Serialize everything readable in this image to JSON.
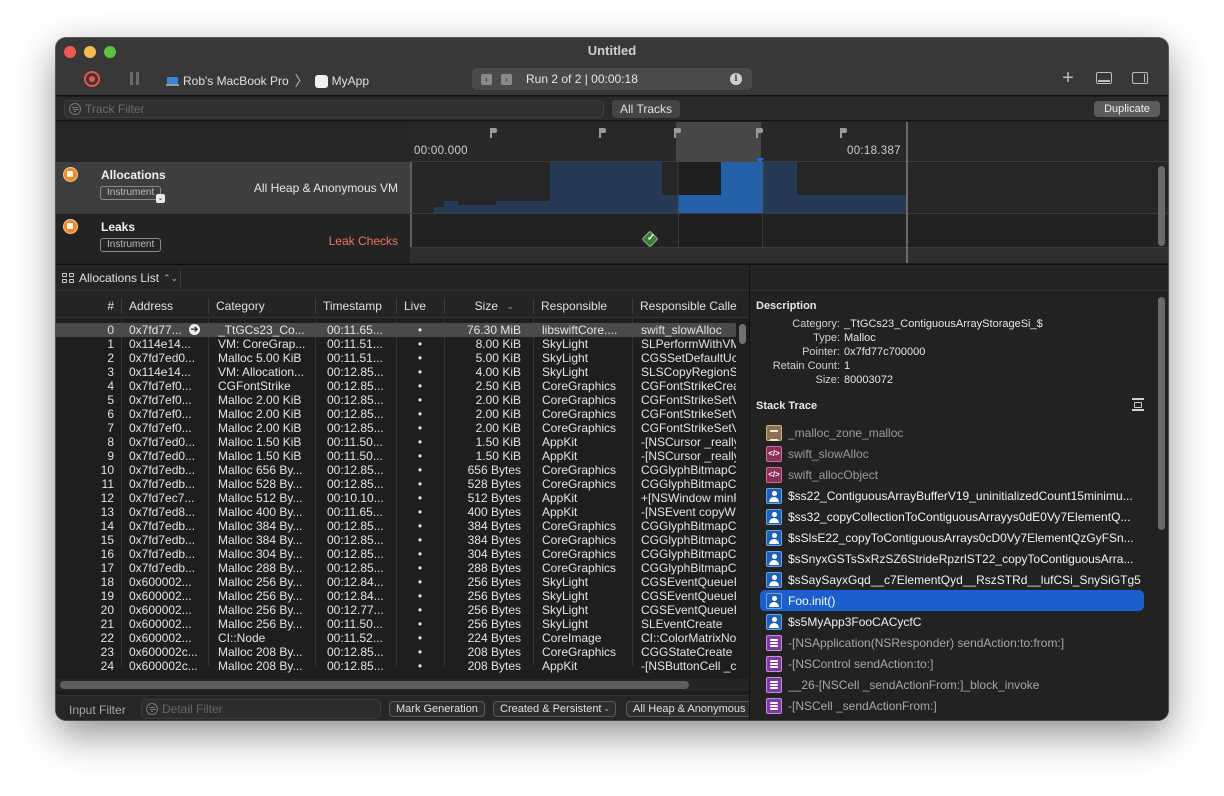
{
  "window": {
    "title": "Untitled",
    "target_device": "Rob's MacBook Pro",
    "target_app": "MyApp",
    "run_label": "Run 2 of 2  |  00:00:18"
  },
  "toolbar": {
    "record_icon": "record-icon",
    "pause_icon": "pause-icon",
    "add_icon": "plus-icon",
    "bottom_panel_icon": "panel-bottom-icon",
    "right_panel_icon": "panel-right-icon",
    "info_icon": "info-icon"
  },
  "filter_bar": {
    "track_filter_placeholder": "Track Filter",
    "all_tracks_label": "All Tracks",
    "duplicate_label": "Duplicate"
  },
  "timeline": {
    "start_label": "00:00.000",
    "end_label": "00:18.387",
    "selection_start_fraction": 0.54,
    "selection_end_fraction": 0.705,
    "tracks": [
      {
        "name": "Allocations",
        "badge": "Instrument",
        "detail": "All Heap & Anonymous VM",
        "icon": "allocations-icon"
      },
      {
        "name": "Leaks",
        "badge": "Instrument",
        "detail": "Leak Checks",
        "icon": "leaks-icon"
      }
    ],
    "leak_check_status": "passed"
  },
  "list": {
    "selector_label": "Allocations List",
    "columns": [
      "#",
      "Address",
      "Category",
      "Timestamp",
      "Live",
      "Size",
      "Responsible",
      "Responsible Calle"
    ],
    "sort_column": "Size",
    "rows": [
      [
        "0",
        "0x7fd77...",
        "_TtGCs23_Co...",
        "00:11.65...",
        "•",
        "76.30 MiB",
        "libswiftCore....",
        "swift_slowAlloc"
      ],
      [
        "1",
        "0x114e14...",
        "VM: CoreGrap...",
        "00:11.51...",
        "•",
        "8.00 KiB",
        "SkyLight",
        "SLPerformWithVM"
      ],
      [
        "2",
        "0x7fd7ed0...",
        "Malloc 5.00 KiB",
        "00:11.51...",
        "•",
        "5.00 KiB",
        "SkyLight",
        "CGSSetDefaultUc"
      ],
      [
        "3",
        "0x114e14...",
        "VM: Allocation...",
        "00:12.85...",
        "•",
        "4.00 KiB",
        "SkyLight",
        "SLSCopyRegionSe"
      ],
      [
        "4",
        "0x7fd7ef0...",
        "CGFontStrike",
        "00:12.85...",
        "•",
        "2.50 KiB",
        "CoreGraphics",
        "CGFontStrikeCrea"
      ],
      [
        "5",
        "0x7fd7ef0...",
        "Malloc 2.00 KiB",
        "00:12.85...",
        "•",
        "2.00 KiB",
        "CoreGraphics",
        "CGFontStrikeSetV"
      ],
      [
        "6",
        "0x7fd7ef0...",
        "Malloc 2.00 KiB",
        "00:12.85...",
        "•",
        "2.00 KiB",
        "CoreGraphics",
        "CGFontStrikeSetV"
      ],
      [
        "7",
        "0x7fd7ef0...",
        "Malloc 2.00 KiB",
        "00:12.85...",
        "•",
        "2.00 KiB",
        "CoreGraphics",
        "CGFontStrikeSetV"
      ],
      [
        "8",
        "0x7fd7ed0...",
        "Malloc 1.50 KiB",
        "00:11.50...",
        "•",
        "1.50 KiB",
        "AppKit",
        "-[NSCursor _really"
      ],
      [
        "9",
        "0x7fd7ed0...",
        "Malloc 1.50 KiB",
        "00:11.50...",
        "•",
        "1.50 KiB",
        "AppKit",
        "-[NSCursor _really"
      ],
      [
        "10",
        "0x7fd7edb...",
        "Malloc 656 By...",
        "00:12.85...",
        "•",
        "656 Bytes",
        "CoreGraphics",
        "CGGlyphBitmapCr"
      ],
      [
        "11",
        "0x7fd7edb...",
        "Malloc 528 By...",
        "00:12.85...",
        "•",
        "528 Bytes",
        "CoreGraphics",
        "CGGlyphBitmapCr"
      ],
      [
        "12",
        "0x7fd7ec7...",
        "Malloc 512 By...",
        "00:10.10...",
        "•",
        "512 Bytes",
        "AppKit",
        "+[NSWindow minF"
      ],
      [
        "13",
        "0x7fd7ed8...",
        "Malloc 400 By...",
        "00:11.65...",
        "•",
        "400 Bytes",
        "AppKit",
        "-[NSEvent copyW"
      ],
      [
        "14",
        "0x7fd7edb...",
        "Malloc 384 By...",
        "00:12.85...",
        "•",
        "384 Bytes",
        "CoreGraphics",
        "CGGlyphBitmapCr"
      ],
      [
        "15",
        "0x7fd7edb...",
        "Malloc 384 By...",
        "00:12.85...",
        "•",
        "384 Bytes",
        "CoreGraphics",
        "CGGlyphBitmapCr"
      ],
      [
        "16",
        "0x7fd7edb...",
        "Malloc 304 By...",
        "00:12.85...",
        "•",
        "304 Bytes",
        "CoreGraphics",
        "CGGlyphBitmapCr"
      ],
      [
        "17",
        "0x7fd7edb...",
        "Malloc 288 By...",
        "00:12.85...",
        "•",
        "288 Bytes",
        "CoreGraphics",
        "CGGlyphBitmapCr"
      ],
      [
        "18",
        "0x600002...",
        "Malloc 256 By...",
        "00:12.84...",
        "•",
        "256 Bytes",
        "SkyLight",
        "CGSEventQueueE"
      ],
      [
        "19",
        "0x600002...",
        "Malloc 256 By...",
        "00:12.84...",
        "•",
        "256 Bytes",
        "SkyLight",
        "CGSEventQueueE"
      ],
      [
        "20",
        "0x600002...",
        "Malloc 256 By...",
        "00:12.77...",
        "•",
        "256 Bytes",
        "SkyLight",
        "CGSEventQueueE"
      ],
      [
        "21",
        "0x600002...",
        "Malloc 256 By...",
        "00:11.50...",
        "•",
        "256 Bytes",
        "SkyLight",
        "SLEventCreate"
      ],
      [
        "22",
        "0x600002...",
        "CI::Node",
        "00:11.52...",
        "•",
        "224 Bytes",
        "CoreImage",
        "CI::ColorMatrixNo"
      ],
      [
        "23",
        "0x600002c...",
        "Malloc 208 By...",
        "00:12.85...",
        "•",
        "208 Bytes",
        "CoreGraphics",
        "CGGStateCreate"
      ],
      [
        "24",
        "0x600002c...",
        "Malloc 208 By...",
        "00:12.85...",
        "•",
        "208 Bytes",
        "AppKit",
        "-[NSButtonCell _c"
      ]
    ],
    "selected_row": 0
  },
  "bottom_bar": {
    "input_filter_label": "Input Filter",
    "detail_filter_placeholder": "Detail Filter",
    "mark_generation_label": "Mark Generation",
    "lifespan_label": "Created & Persistent",
    "allocation_type_label": "All Heap & Anonymous VM"
  },
  "inspector": {
    "description_title": "Description",
    "fields": [
      {
        "key": "Category:",
        "value": "_TtGCs23_ContiguousArrayStorageSi_$"
      },
      {
        "key": "Type:",
        "value": "Malloc"
      },
      {
        "key": "Pointer:",
        "value": "0x7fd77c700000"
      },
      {
        "key": "Retain Count:",
        "value": "1"
      },
      {
        "key": "Size:",
        "value": "80003072"
      }
    ],
    "stack_title": "Stack Trace",
    "frames": [
      {
        "label": "_malloc_zone_malloc",
        "kind": "lib",
        "icon": "system-library-icon"
      },
      {
        "label": "swift_slowAlloc",
        "kind": "code",
        "icon": "swift-code-icon"
      },
      {
        "label": "swift_allocObject",
        "kind": "code",
        "icon": "swift-code-icon"
      },
      {
        "label": "$ss22_ContiguousArrayBufferV19_uninitializedCount15minimu...",
        "kind": "user",
        "icon": "user-code-icon"
      },
      {
        "label": "$ss32_copyCollectionToContiguousArrayys0dE0Vy7ElementQ...",
        "kind": "user",
        "icon": "user-code-icon"
      },
      {
        "label": "$sSlsE22_copyToContiguousArrays0cD0Vy7ElementQzGyFSn...",
        "kind": "user",
        "icon": "user-code-icon"
      },
      {
        "label": "$sSnyxGSTsSxRzSZ6StrideRpzrlST22_copyToContiguousArra...",
        "kind": "user",
        "icon": "user-code-icon"
      },
      {
        "label": "$sSaySayxGqd__c7ElementQyd__RszSTRd__lufCSi_SnySiGTg5",
        "kind": "user",
        "icon": "user-code-icon"
      },
      {
        "label": "Foo.init()",
        "kind": "user",
        "icon": "user-code-icon",
        "selected": true
      },
      {
        "label": "$s5MyApp3FooCACycfC",
        "kind": "user",
        "icon": "user-code-icon"
      },
      {
        "label": "-[NSApplication(NSResponder) sendAction:to:from:]",
        "kind": "fw",
        "icon": "framework-icon"
      },
      {
        "label": "-[NSControl sendAction:to:]",
        "kind": "fw",
        "icon": "framework-icon"
      },
      {
        "label": "__26-[NSCell _sendActionFrom:]_block_invoke",
        "kind": "fw",
        "icon": "framework-icon"
      },
      {
        "label": "-[NSCell _sendActionFrom:]",
        "kind": "fw",
        "icon": "framework-icon"
      }
    ]
  },
  "colors": {
    "accent": "#1b5fcc",
    "record": "#ef5347",
    "instrument": "#f08a2c",
    "leak_text": "#ee7260",
    "graph_dim": "#263a56",
    "graph_bright": "#2461a8"
  }
}
